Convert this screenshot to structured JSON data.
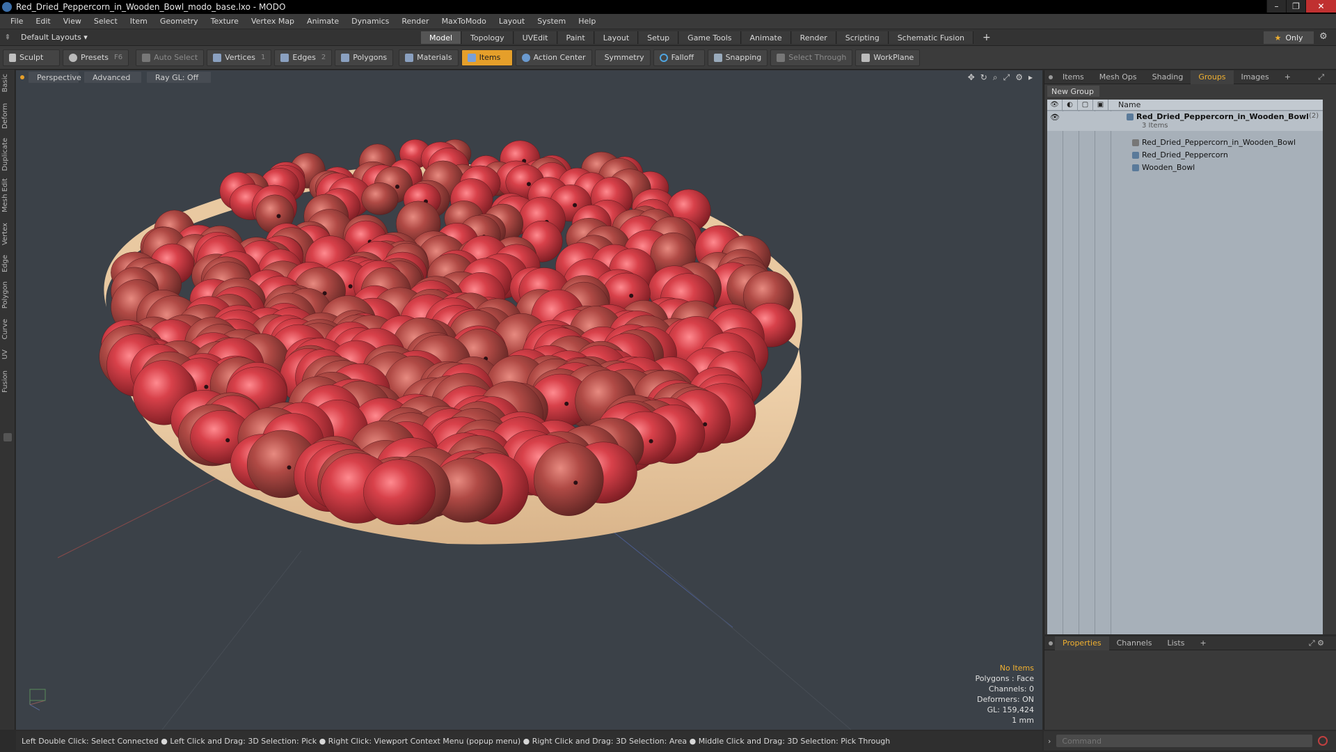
{
  "window": {
    "title": "Red_Dried_Peppercorn_in_Wooden_Bowl_modo_base.lxo - MODO"
  },
  "menu": [
    "File",
    "Edit",
    "View",
    "Select",
    "Item",
    "Geometry",
    "Texture",
    "Vertex Map",
    "Animate",
    "Dynamics",
    "Render",
    "MaxToModo",
    "Layout",
    "System",
    "Help"
  ],
  "layoutbar": {
    "layouts_label": "Default Layouts ▾",
    "tabs": [
      "Model",
      "Topology",
      "UVEdit",
      "Paint",
      "Layout",
      "Setup",
      "Game Tools",
      "Animate",
      "Render",
      "Scripting",
      "Schematic Fusion"
    ],
    "active_tab": "Model",
    "only_label": "Only"
  },
  "toolbar": {
    "sculpt": "Sculpt",
    "presets": "Presets",
    "presets_key": "F6",
    "auto_select": "Auto Select",
    "vertices": "Vertices",
    "vertices_key": "1",
    "edges": "Edges",
    "edges_key": "2",
    "polygons": "Polygons",
    "materials": "Materials",
    "items": "Items",
    "action_center": "Action Center",
    "symmetry": "Symmetry",
    "falloff": "Falloff",
    "snapping": "Snapping",
    "select_through": "Select Through",
    "workplane": "WorkPlane"
  },
  "left_tabs": [
    "Basic",
    "Deform",
    "Duplicate",
    "Mesh Edit",
    "Vertex",
    "Edge",
    "Polygon",
    "Curve",
    "UV",
    "Fusion"
  ],
  "viewport": {
    "perspective": "Perspective",
    "advanced": "Advanced",
    "raygl": "Ray GL: Off",
    "info": {
      "no_items": "No Items",
      "polygons": "Polygons : Face",
      "channels": "Channels: 0",
      "deformers": "Deformers: ON",
      "gl": "GL: 159,424",
      "unit": "1 mm"
    },
    "colors": {
      "background": "#3b4148",
      "bowl": "#e8c39a",
      "peppercorn": "#c8383e"
    }
  },
  "statusbar": {
    "text": "Left Double Click: Select Connected ● Left Click and Drag: 3D Selection: Pick ● Right Click: Viewport Context Menu (popup menu) ● Right Click and Drag: 3D Selection: Area ● Middle Click and Drag: 3D Selection: Pick Through"
  },
  "right_panel": {
    "tabs": [
      "Items",
      "Mesh Ops",
      "Shading",
      "Groups",
      "Images"
    ],
    "active_tab": "Groups",
    "new_group": "New Group",
    "column_name": "Name",
    "tree": {
      "root": "Red_Dried_Peppercorn_in_Wooden_Bowl",
      "root_count": "(2)",
      "root_sub": "3 Items",
      "children": [
        "Red_Dried_Peppercorn_in_Wooden_Bowl",
        "Red_Dried_Peppercorn",
        "Wooden_Bowl"
      ]
    }
  },
  "props_panel": {
    "tabs": [
      "Properties",
      "Channels",
      "Lists"
    ],
    "active_tab": "Properties"
  },
  "command": {
    "placeholder": "Command"
  }
}
